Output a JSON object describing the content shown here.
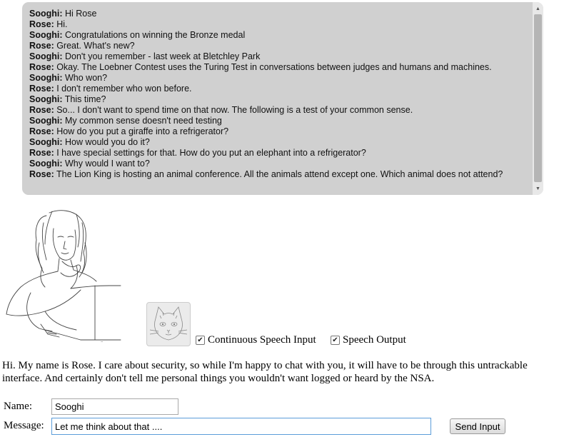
{
  "chat": {
    "lines": [
      {
        "speaker": "Sooghi:",
        "text": " Hi Rose"
      },
      {
        "speaker": "Rose:",
        "text": " Hi."
      },
      {
        "speaker": "Sooghi:",
        "text": " Congratulations on winning the Bronze medal"
      },
      {
        "speaker": "Rose:",
        "text": " Great. What's new?"
      },
      {
        "speaker": "Sooghi:",
        "text": " Don't you remember - last week at Bletchley Park"
      },
      {
        "speaker": "Rose:",
        "text": " Okay. The Loebner Contest uses the Turing Test in conversations between judges and humans and machines."
      },
      {
        "speaker": "Sooghi:",
        "text": " Who won?"
      },
      {
        "speaker": "Rose:",
        "text": " I don't remember who won before."
      },
      {
        "speaker": "Sooghi:",
        "text": " This time?"
      },
      {
        "speaker": "Rose:",
        "text": " So... I don't want to spend time on that now. The following is a test of your common sense."
      },
      {
        "speaker": "Sooghi:",
        "text": " My common sense doesn't need testing"
      },
      {
        "speaker": "Rose:",
        "text": " How do you put a giraffe into a refrigerator?"
      },
      {
        "speaker": "Sooghi:",
        "text": " How would you do it?"
      },
      {
        "speaker": "Rose:",
        "text": " I have special settings for that. How do you put an elephant into a refrigerator?"
      },
      {
        "speaker": "Sooghi:",
        "text": " Why would I want to?"
      },
      {
        "speaker": "Rose:",
        "text": " The Lion King is hosting an animal conference. All the animals attend except one. Which animal does not attend?"
      }
    ]
  },
  "options": {
    "continuous_label": "Continuous Speech Input",
    "continuous_checked": true,
    "speech_output_label": "Speech Output",
    "speech_output_checked": true
  },
  "intro_text": "Hi. My name is Rose. I care about security, so while I'm happy to chat with you, it will have to be through this untrackable interface. And certainly don't tell me personal things you wouldn't want logged or heard by the NSA.",
  "form": {
    "name_label": "Name:",
    "name_value": "Sooghi",
    "message_label": "Message:",
    "message_value": "Let me think about that ....",
    "send_label": "Send Input"
  },
  "icons": {
    "scroll_up": "scroll-up-arrow-icon",
    "scroll_down": "scroll-down-arrow-icon",
    "rose_avatar": "rose-sketch-portrait",
    "user_avatar": "kitten-avatar",
    "checkmark": "checkmark-icon"
  }
}
